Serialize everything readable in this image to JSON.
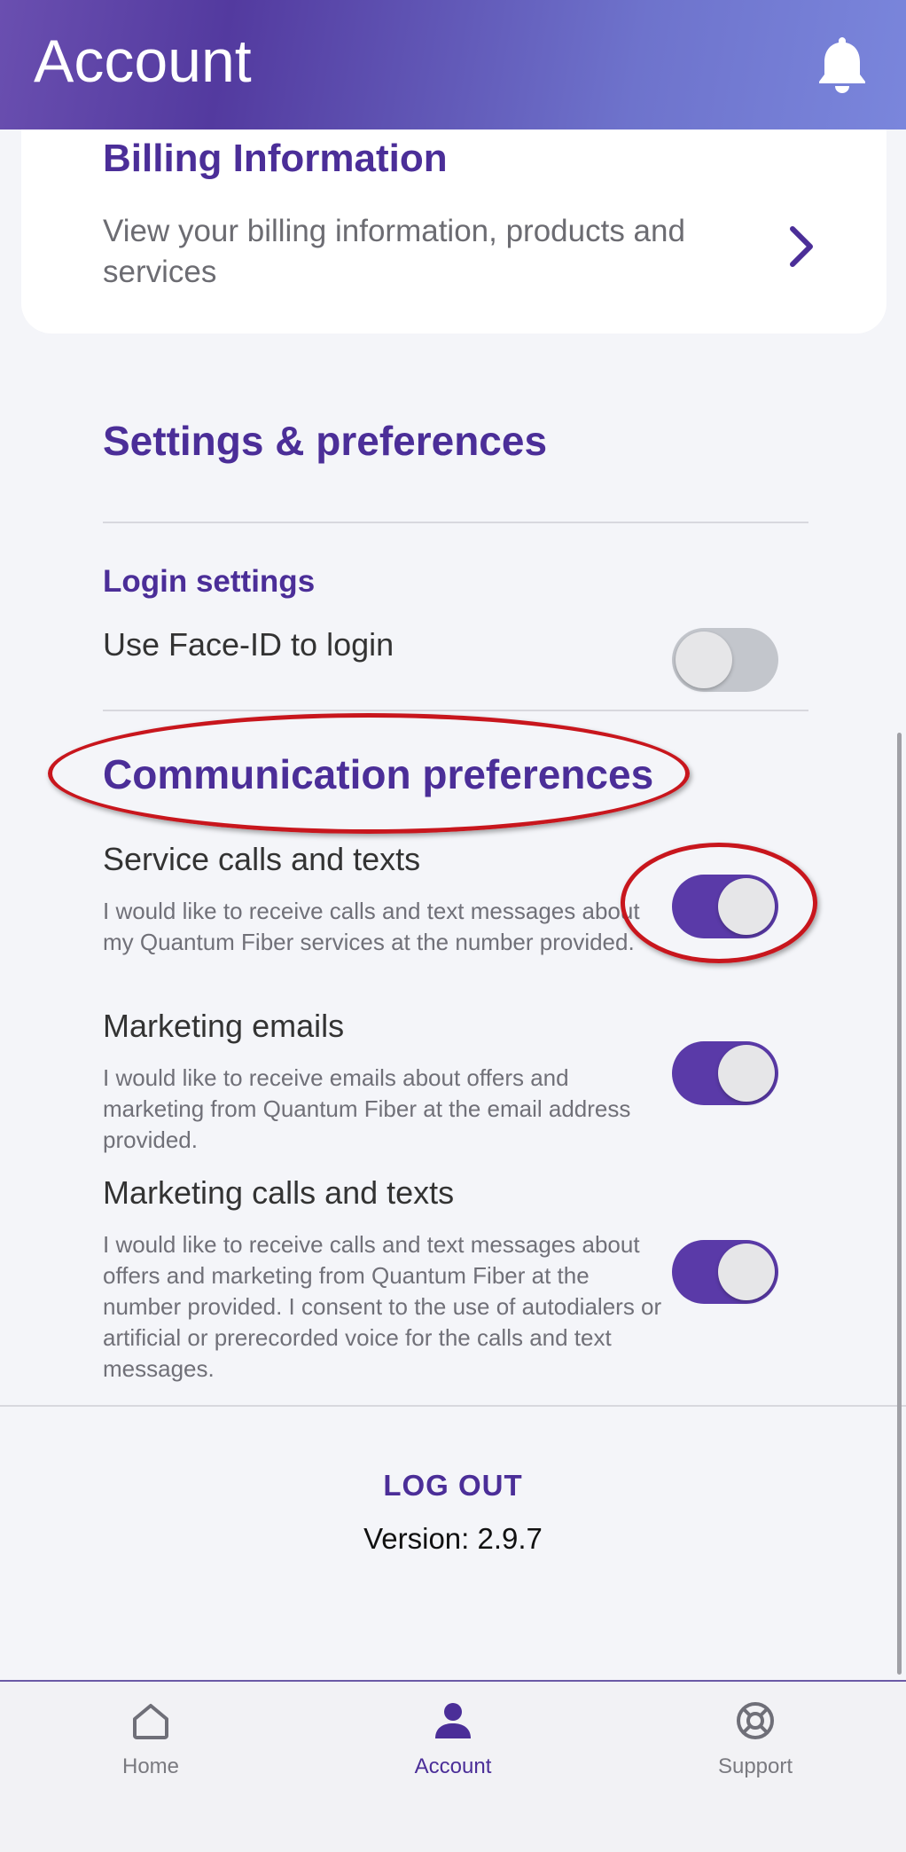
{
  "header": {
    "title": "Account",
    "notifications_icon": "bell-icon"
  },
  "billing": {
    "title": "Billing Information",
    "description": "View your billing information, products and services",
    "chevron_icon": "chevron-right-icon"
  },
  "settings": {
    "title": "Settings & preferences",
    "login": {
      "title": "Login settings",
      "face_id_label": "Use Face-ID to login",
      "face_id_enabled": false
    },
    "communication": {
      "title": "Communication preferences",
      "items": [
        {
          "label": "Service calls and texts",
          "description": "I would like to receive calls and text messages about my Quantum Fiber services at the number provided.",
          "enabled": true
        },
        {
          "label": "Marketing emails",
          "description": "I would like to receive emails about offers and marketing from Quantum Fiber at the email address provided.",
          "enabled": true
        },
        {
          "label": "Marketing calls and texts",
          "description": "I would like to receive calls and text messages about offers and marketing from Quantum Fiber at the number provided. I consent to the use of autodialers or artificial or prerecorded voice for the calls and text messages.",
          "enabled": true
        }
      ]
    }
  },
  "footer": {
    "logout_label": "LOG OUT",
    "version": "Version: 2.9.7"
  },
  "tabbar": {
    "items": [
      {
        "label": "Home",
        "icon": "home-icon",
        "active": false
      },
      {
        "label": "Account",
        "icon": "person-icon",
        "active": true
      },
      {
        "label": "Support",
        "icon": "lifebuoy-icon",
        "active": false
      }
    ]
  },
  "colors": {
    "brand_purple": "#4b2e98",
    "toggle_on": "#5a3aa8",
    "toggle_off": "#c3c6cc",
    "annotation_red": "#c8161d"
  }
}
